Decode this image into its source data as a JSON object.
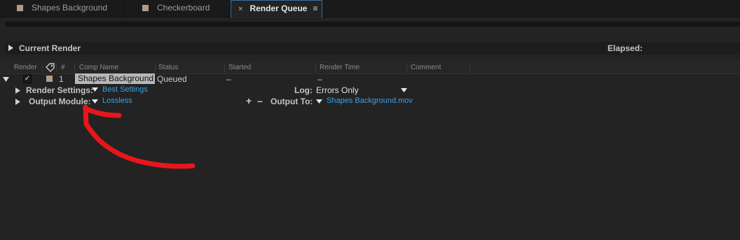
{
  "tabs": [
    {
      "label": "Shapes Background",
      "active": false
    },
    {
      "label": "Checkerboard",
      "active": false
    },
    {
      "label": "Render Queue",
      "active": true
    }
  ],
  "tab_close_glyph": "×",
  "tab_menu_glyph": "≡",
  "current_render": {
    "label": "Current Render",
    "elapsed_label": "Elapsed:"
  },
  "columns": [
    "Render",
    "#",
    "Comp Name",
    "Status",
    "Started",
    "Render Time",
    "Comment"
  ],
  "item": {
    "number": "1",
    "comp_name": "Shapes Background",
    "status": "Queued",
    "started": "–",
    "render_time": "–",
    "render_checked": true
  },
  "render_settings": {
    "label": "Render Settings:",
    "value": "Best Settings"
  },
  "log": {
    "label": "Log:",
    "value": "Errors Only"
  },
  "output_module": {
    "label": "Output Module:",
    "value": "Lossless"
  },
  "output_to": {
    "label": "Output To:",
    "value": "Shapes Background.mov"
  },
  "buttons": {
    "add": "+",
    "remove": "–"
  },
  "colors": {
    "accent_link": "#3ca1e4",
    "annotation_arrow": "#e8161b",
    "label_swatch": "#b19d85"
  },
  "icons": [
    "expand-triangle-icon",
    "tag-icon",
    "dropdown-icon",
    "checkmark-icon"
  ]
}
